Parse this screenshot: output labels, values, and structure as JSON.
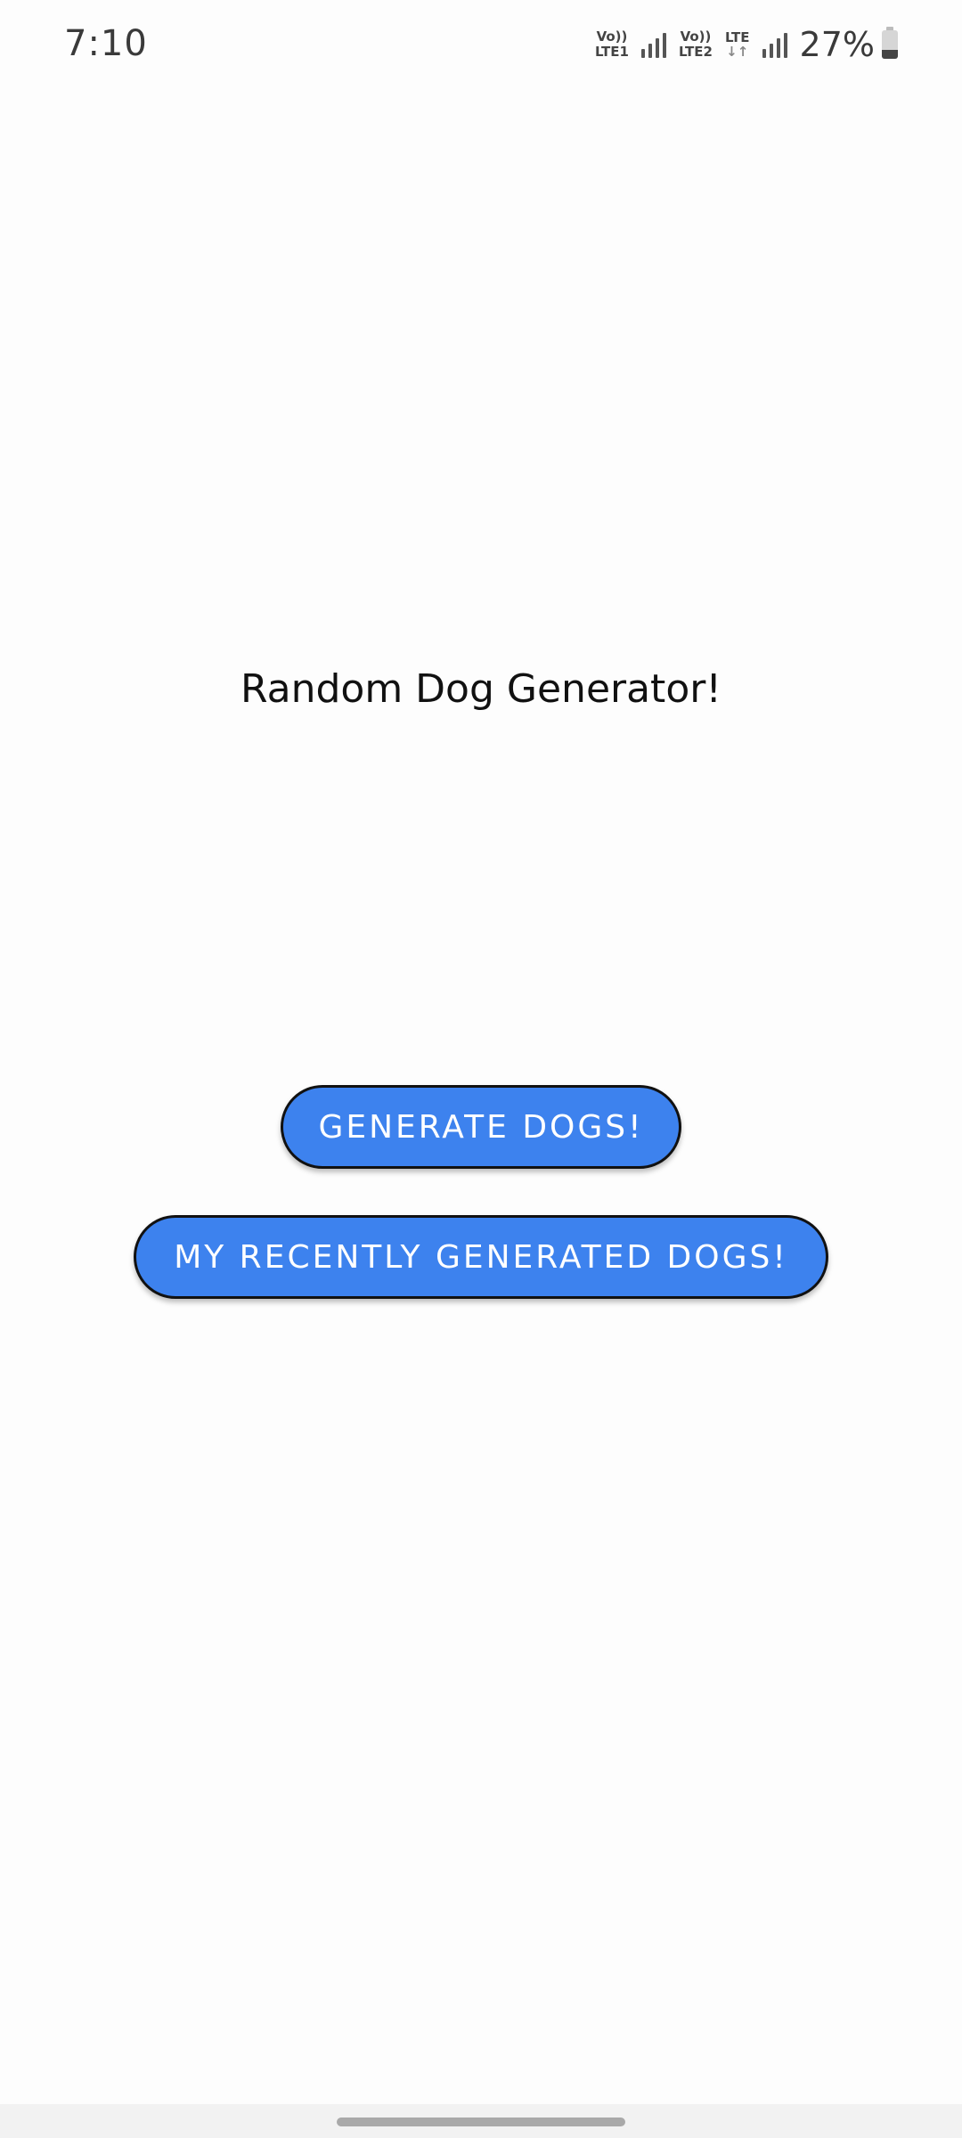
{
  "status_bar": {
    "time": "7:10",
    "sim1": {
      "top": "Vo))",
      "bottom": "LTE1"
    },
    "sim2": {
      "top": "Vo))",
      "bottom": "LTE2"
    },
    "data_network": {
      "top": "LTE",
      "bottom": "↓↑"
    },
    "battery_percent": "27%",
    "battery_level": 0.27,
    "icons": [
      "signal-icon",
      "signal-icon",
      "battery-icon"
    ]
  },
  "main": {
    "title": "Random Dog Generator!",
    "generate_button_label": "GENERATE DOGS!",
    "recent_button_label": "MY RECENTLY GENERATED DOGS!"
  },
  "colors": {
    "button_fill": "#3d82ee",
    "button_text": "#ffffff",
    "button_border": "#111111",
    "background": "#fdfdfd"
  }
}
